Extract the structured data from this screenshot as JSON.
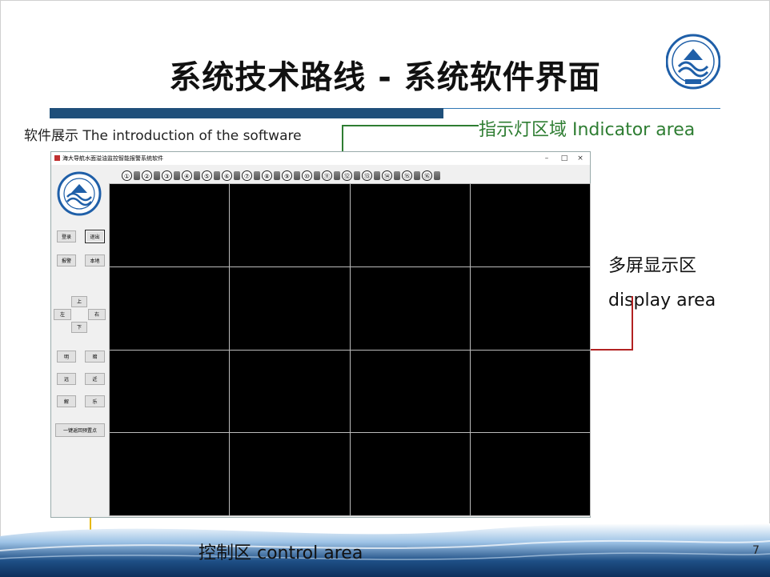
{
  "slide": {
    "title": "系统技术路线 - 系统软件界面",
    "subtitle": "软件展示 The introduction of the software",
    "page_number": "7"
  },
  "annotations": {
    "indicator": "指示灯区域 Indicator area",
    "display_line1": "多屏显示区",
    "display_line2": "display area",
    "control": "控制区  control area"
  },
  "window": {
    "title": "海大导航水面溢油监控智能报警系统软件",
    "min": "–",
    "max": "□",
    "close": "×"
  },
  "indicators": [
    "①",
    "②",
    "③",
    "④",
    "⑤",
    "⑥",
    "⑦",
    "⑧",
    "⑨",
    "⑩",
    "⑪",
    "⑫",
    "⑬",
    "⑭",
    "⑮",
    "⑯"
  ],
  "controls": {
    "login": "登录",
    "exit": "退出",
    "alarm": "报警",
    "local": "本地",
    "up": "上",
    "left": "左",
    "right": "右",
    "down": "下",
    "bright": "明",
    "dark": "暗",
    "far": "远",
    "near": "近",
    "solve": "解",
    "music": "乐",
    "return_preset": "一键返回预置点"
  },
  "colors": {
    "accent_blue": "#1f4f7a",
    "indicator_green": "#2e7d32",
    "display_pointer": "#b22222",
    "control_pointer": "#e6b800"
  }
}
